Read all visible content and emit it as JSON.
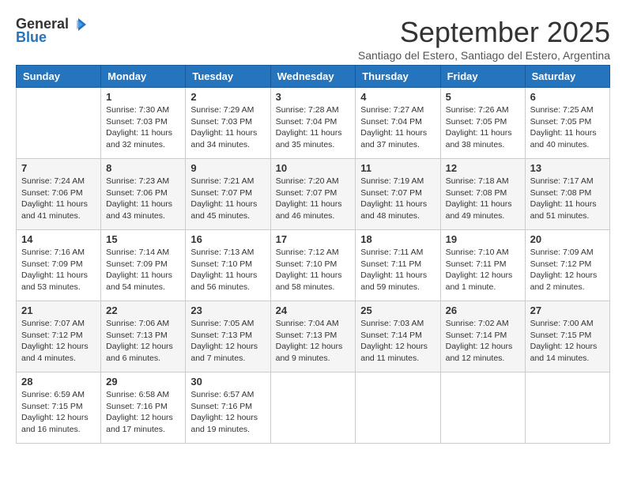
{
  "logo": {
    "line1": "General",
    "line2": "Blue"
  },
  "title": "September 2025",
  "subtitle": "Santiago del Estero, Santiago del Estero, Argentina",
  "weekdays": [
    "Sunday",
    "Monday",
    "Tuesday",
    "Wednesday",
    "Thursday",
    "Friday",
    "Saturday"
  ],
  "weeks": [
    [
      {
        "day": "",
        "info": ""
      },
      {
        "day": "1",
        "info": "Sunrise: 7:30 AM\nSunset: 7:03 PM\nDaylight: 11 hours\nand 32 minutes."
      },
      {
        "day": "2",
        "info": "Sunrise: 7:29 AM\nSunset: 7:03 PM\nDaylight: 11 hours\nand 34 minutes."
      },
      {
        "day": "3",
        "info": "Sunrise: 7:28 AM\nSunset: 7:04 PM\nDaylight: 11 hours\nand 35 minutes."
      },
      {
        "day": "4",
        "info": "Sunrise: 7:27 AM\nSunset: 7:04 PM\nDaylight: 11 hours\nand 37 minutes."
      },
      {
        "day": "5",
        "info": "Sunrise: 7:26 AM\nSunset: 7:05 PM\nDaylight: 11 hours\nand 38 minutes."
      },
      {
        "day": "6",
        "info": "Sunrise: 7:25 AM\nSunset: 7:05 PM\nDaylight: 11 hours\nand 40 minutes."
      }
    ],
    [
      {
        "day": "7",
        "info": "Sunrise: 7:24 AM\nSunset: 7:06 PM\nDaylight: 11 hours\nand 41 minutes."
      },
      {
        "day": "8",
        "info": "Sunrise: 7:23 AM\nSunset: 7:06 PM\nDaylight: 11 hours\nand 43 minutes."
      },
      {
        "day": "9",
        "info": "Sunrise: 7:21 AM\nSunset: 7:07 PM\nDaylight: 11 hours\nand 45 minutes."
      },
      {
        "day": "10",
        "info": "Sunrise: 7:20 AM\nSunset: 7:07 PM\nDaylight: 11 hours\nand 46 minutes."
      },
      {
        "day": "11",
        "info": "Sunrise: 7:19 AM\nSunset: 7:07 PM\nDaylight: 11 hours\nand 48 minutes."
      },
      {
        "day": "12",
        "info": "Sunrise: 7:18 AM\nSunset: 7:08 PM\nDaylight: 11 hours\nand 49 minutes."
      },
      {
        "day": "13",
        "info": "Sunrise: 7:17 AM\nSunset: 7:08 PM\nDaylight: 11 hours\nand 51 minutes."
      }
    ],
    [
      {
        "day": "14",
        "info": "Sunrise: 7:16 AM\nSunset: 7:09 PM\nDaylight: 11 hours\nand 53 minutes."
      },
      {
        "day": "15",
        "info": "Sunrise: 7:14 AM\nSunset: 7:09 PM\nDaylight: 11 hours\nand 54 minutes."
      },
      {
        "day": "16",
        "info": "Sunrise: 7:13 AM\nSunset: 7:10 PM\nDaylight: 11 hours\nand 56 minutes."
      },
      {
        "day": "17",
        "info": "Sunrise: 7:12 AM\nSunset: 7:10 PM\nDaylight: 11 hours\nand 58 minutes."
      },
      {
        "day": "18",
        "info": "Sunrise: 7:11 AM\nSunset: 7:11 PM\nDaylight: 11 hours\nand 59 minutes."
      },
      {
        "day": "19",
        "info": "Sunrise: 7:10 AM\nSunset: 7:11 PM\nDaylight: 12 hours\nand 1 minute."
      },
      {
        "day": "20",
        "info": "Sunrise: 7:09 AM\nSunset: 7:12 PM\nDaylight: 12 hours\nand 2 minutes."
      }
    ],
    [
      {
        "day": "21",
        "info": "Sunrise: 7:07 AM\nSunset: 7:12 PM\nDaylight: 12 hours\nand 4 minutes."
      },
      {
        "day": "22",
        "info": "Sunrise: 7:06 AM\nSunset: 7:13 PM\nDaylight: 12 hours\nand 6 minutes."
      },
      {
        "day": "23",
        "info": "Sunrise: 7:05 AM\nSunset: 7:13 PM\nDaylight: 12 hours\nand 7 minutes."
      },
      {
        "day": "24",
        "info": "Sunrise: 7:04 AM\nSunset: 7:13 PM\nDaylight: 12 hours\nand 9 minutes."
      },
      {
        "day": "25",
        "info": "Sunrise: 7:03 AM\nSunset: 7:14 PM\nDaylight: 12 hours\nand 11 minutes."
      },
      {
        "day": "26",
        "info": "Sunrise: 7:02 AM\nSunset: 7:14 PM\nDaylight: 12 hours\nand 12 minutes."
      },
      {
        "day": "27",
        "info": "Sunrise: 7:00 AM\nSunset: 7:15 PM\nDaylight: 12 hours\nand 14 minutes."
      }
    ],
    [
      {
        "day": "28",
        "info": "Sunrise: 6:59 AM\nSunset: 7:15 PM\nDaylight: 12 hours\nand 16 minutes."
      },
      {
        "day": "29",
        "info": "Sunrise: 6:58 AM\nSunset: 7:16 PM\nDaylight: 12 hours\nand 17 minutes."
      },
      {
        "day": "30",
        "info": "Sunrise: 6:57 AM\nSunset: 7:16 PM\nDaylight: 12 hours\nand 19 minutes."
      },
      {
        "day": "",
        "info": ""
      },
      {
        "day": "",
        "info": ""
      },
      {
        "day": "",
        "info": ""
      },
      {
        "day": "",
        "info": ""
      }
    ]
  ]
}
